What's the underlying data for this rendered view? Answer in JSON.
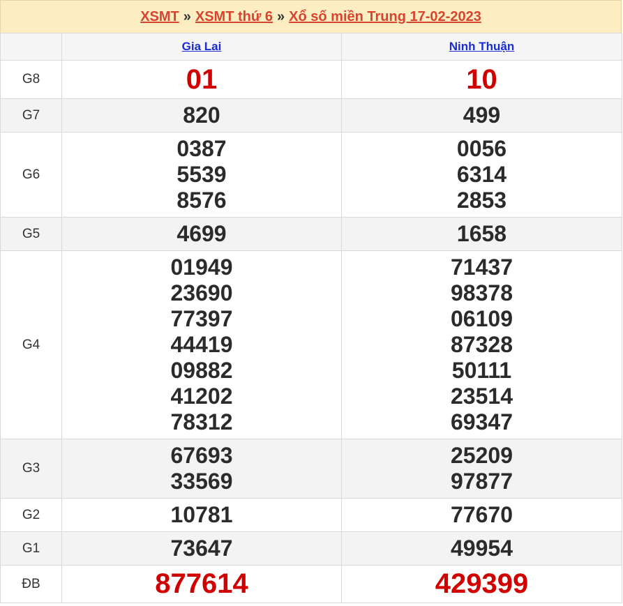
{
  "header": {
    "link1": "XSMT",
    "sep1": "»",
    "link2": "XSMT thứ 6",
    "sep2": "»",
    "link3": "Xổ số miền Trung 17-02-2023"
  },
  "provinces": [
    "Gia Lai",
    "Ninh Thuận"
  ],
  "prizes": {
    "g8": {
      "label": "G8",
      "col1": [
        "01"
      ],
      "col2": [
        "10"
      ]
    },
    "g7": {
      "label": "G7",
      "col1": [
        "820"
      ],
      "col2": [
        "499"
      ]
    },
    "g6": {
      "label": "G6",
      "col1": [
        "0387",
        "5539",
        "8576"
      ],
      "col2": [
        "0056",
        "6314",
        "2853"
      ]
    },
    "g5": {
      "label": "G5",
      "col1": [
        "4699"
      ],
      "col2": [
        "1658"
      ]
    },
    "g4": {
      "label": "G4",
      "col1": [
        "01949",
        "23690",
        "77397",
        "44419",
        "09882",
        "41202",
        "78312"
      ],
      "col2": [
        "71437",
        "98378",
        "06109",
        "87328",
        "50111",
        "23514",
        "69347"
      ]
    },
    "g3": {
      "label": "G3",
      "col1": [
        "67693",
        "33569"
      ],
      "col2": [
        "25209",
        "97877"
      ]
    },
    "g2": {
      "label": "G2",
      "col1": [
        "10781"
      ],
      "col2": [
        "77670"
      ]
    },
    "g1": {
      "label": "G1",
      "col1": [
        "73647"
      ],
      "col2": [
        "49954"
      ]
    },
    "db": {
      "label": "ĐB",
      "col1": [
        "877614"
      ],
      "col2": [
        "429399"
      ]
    }
  },
  "colors": {
    "special": "#d10000",
    "link": "#1a2ccf",
    "header_link": "#d6452f",
    "header_bg": "#fcedc3"
  }
}
